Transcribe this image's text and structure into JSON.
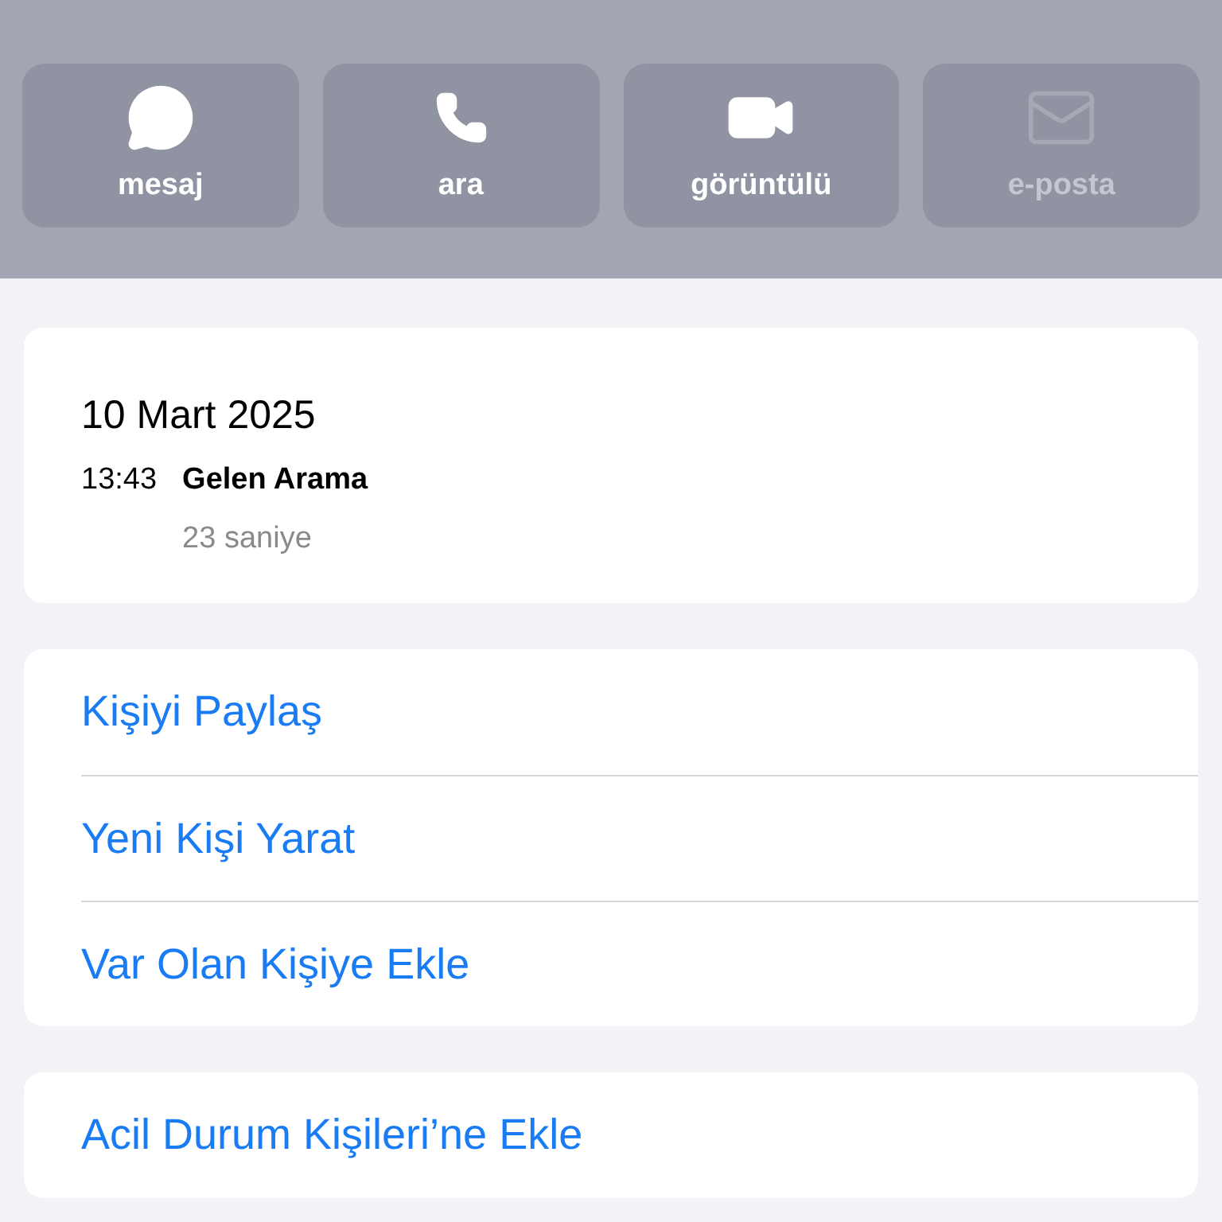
{
  "actions": [
    {
      "kind": "message",
      "label": "mesaj",
      "disabled": false
    },
    {
      "kind": "call",
      "label": "ara",
      "disabled": false
    },
    {
      "kind": "video",
      "label": "görüntülü",
      "disabled": false
    },
    {
      "kind": "mail",
      "label": "e-posta",
      "disabled": true
    }
  ],
  "call_log": {
    "date": "10 Mart 2025",
    "entries": [
      {
        "time": "13:43",
        "type": "Gelen Arama",
        "duration": "23 saniye"
      }
    ]
  },
  "contact_actions": [
    "Kişiyi Paylaş",
    "Yeni Kişi Yarat",
    "Var Olan Kişiye Ekle"
  ],
  "emergency_action": "Acil Durum Kişileri’ne Ekle"
}
